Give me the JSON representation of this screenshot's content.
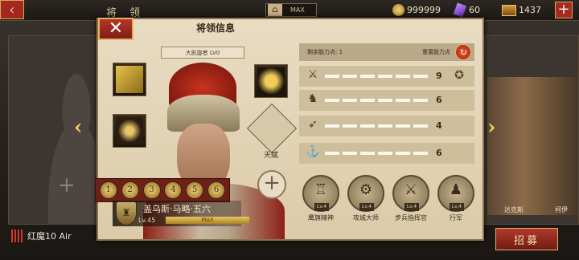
{
  "topbar": {
    "title": "将 领",
    "max_label": "MAX",
    "coins": "999999",
    "gems": "60",
    "chests": "1437"
  },
  "panel": {
    "title": "将领信息",
    "rank_label": "大凯旋者 LV0",
    "talent_label": "天赋"
  },
  "hero": {
    "name": "盖乌斯·马略·五六",
    "level": "Lv.45",
    "exp_label": "MAX",
    "exp_progress": 1.0
  },
  "stats": {
    "remaining_label": "剩余能力点: 1",
    "reset_label": "重置能力点",
    "rows": [
      {
        "icon": "sword-icon",
        "value": "9"
      },
      {
        "icon": "horse-icon",
        "value": "6"
      },
      {
        "icon": "bow-icon",
        "value": "4"
      },
      {
        "icon": "anchor-icon",
        "value": "6"
      }
    ]
  },
  "abilities": [
    {
      "name": "鹰旗精神",
      "level": "Lv.4"
    },
    {
      "name": "攻城大师",
      "level": "Lv.4"
    },
    {
      "name": "步兵指挥官",
      "level": "Lv.4"
    },
    {
      "name": "行军",
      "level": "Lv.4"
    }
  ],
  "side": {
    "right_name_1": "达克斯",
    "right_name_2": "柯伊"
  },
  "device": {
    "brand": "红魔10 Air"
  },
  "recruit": {
    "label": "招募"
  },
  "skills": [
    "1",
    "2",
    "3",
    "4",
    "5",
    "6"
  ],
  "colors": {
    "accent": "#a52a1f",
    "gold": "#e8c75c",
    "panel": "#e9dcc2"
  }
}
